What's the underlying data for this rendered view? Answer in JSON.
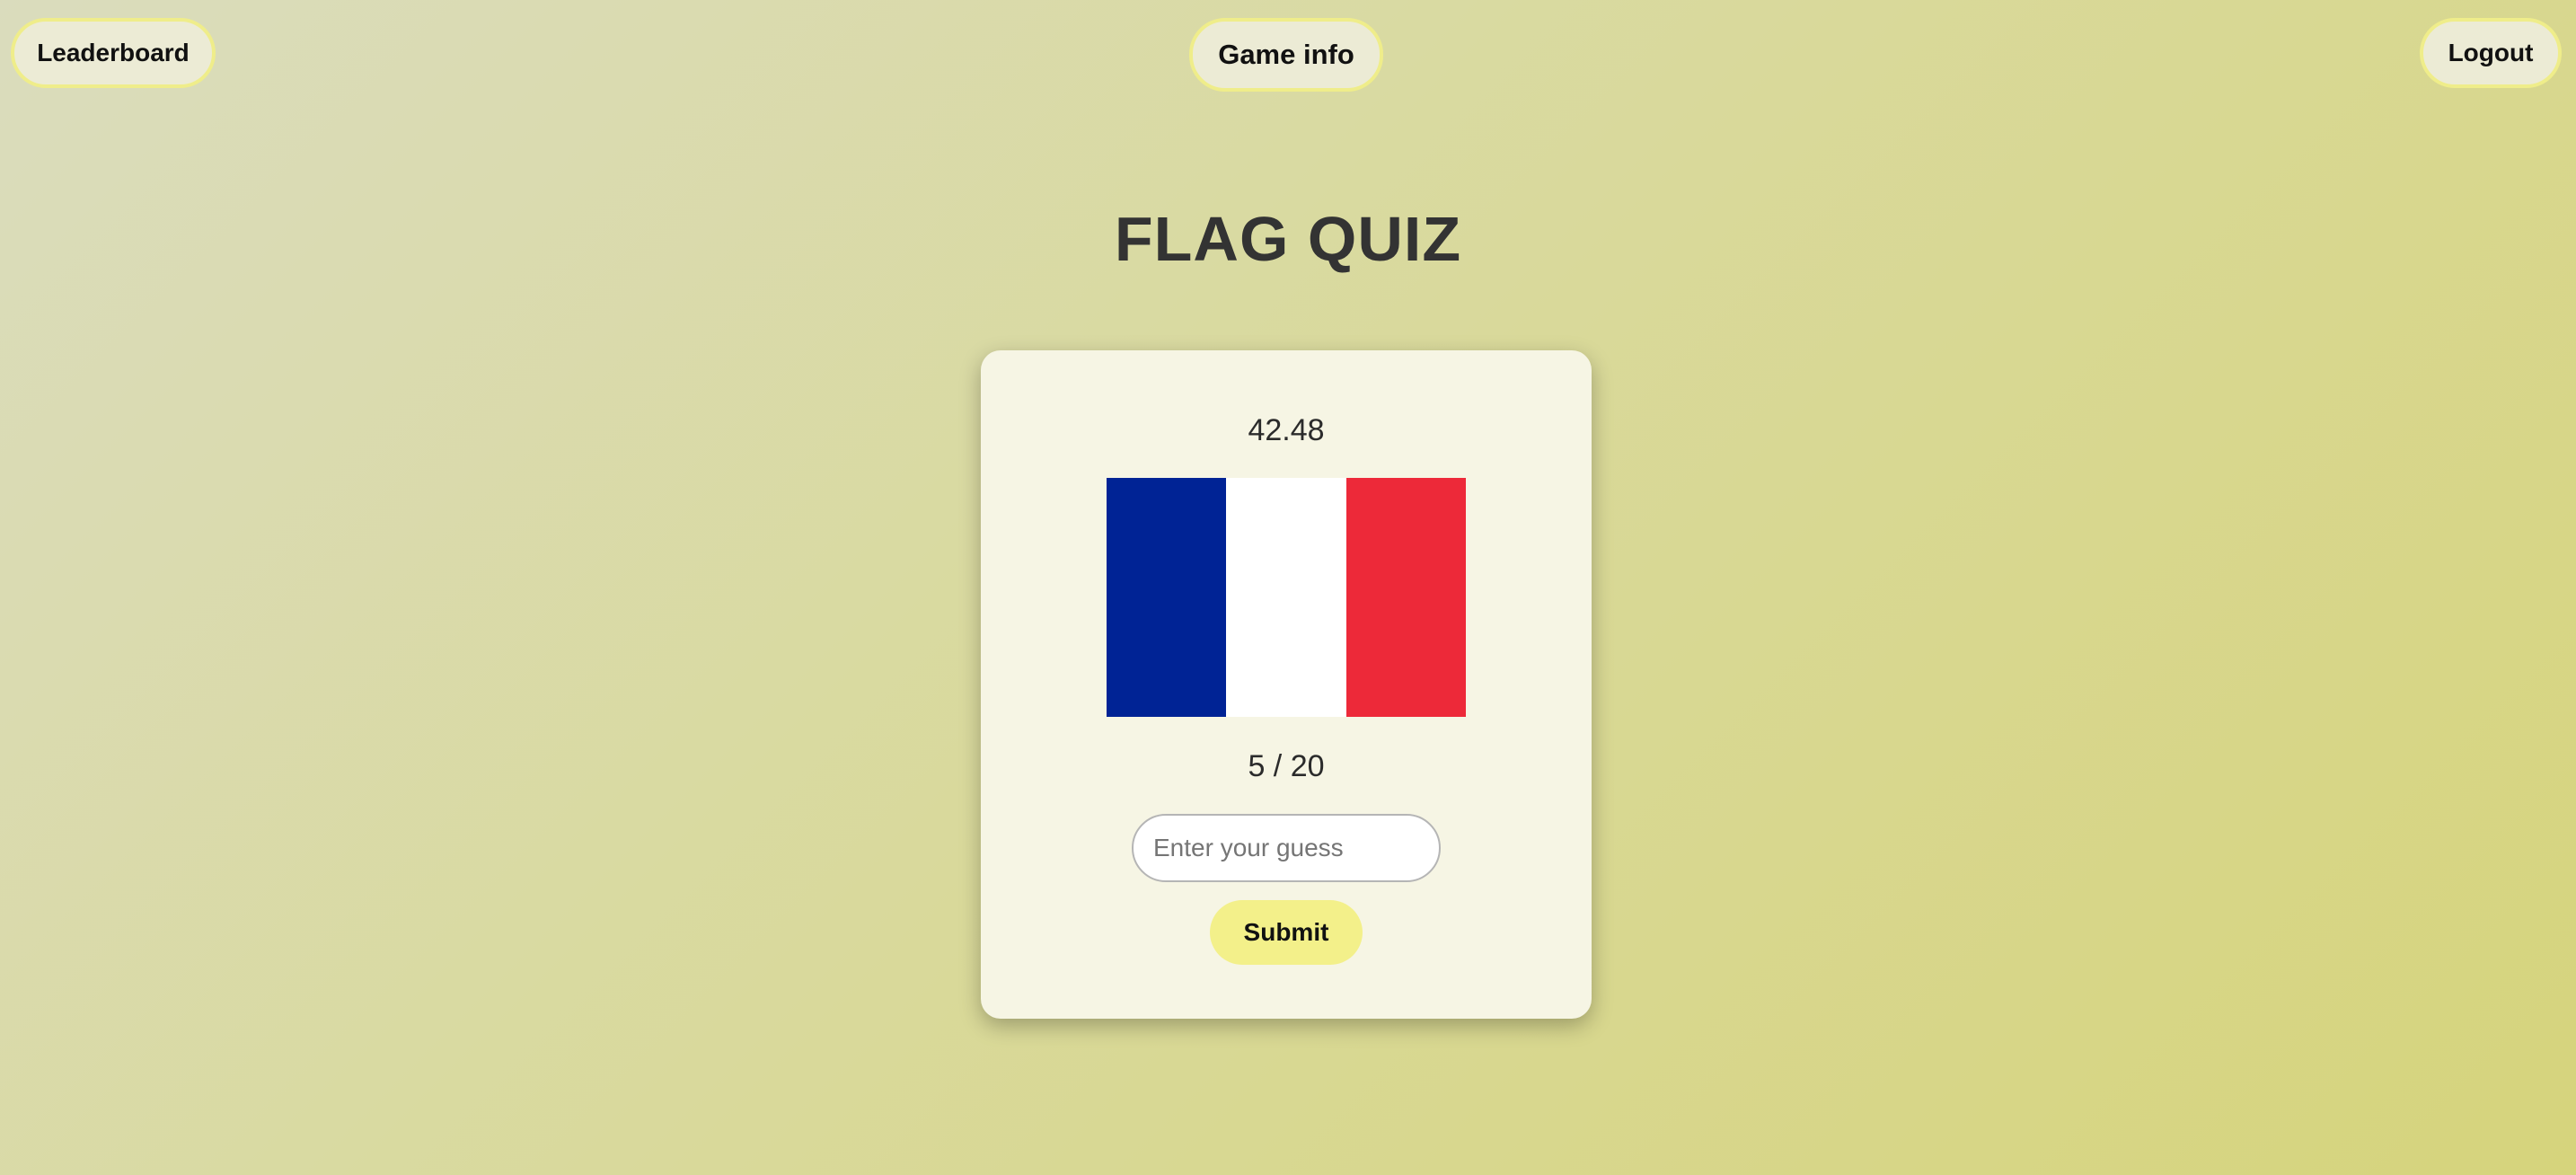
{
  "nav": {
    "leaderboard_label": "Leaderboard",
    "game_info_label": "Game info",
    "logout_label": "Logout"
  },
  "page": {
    "title": "FLAG QUIZ"
  },
  "quiz": {
    "timer": "42.48",
    "progress": "5 / 20",
    "guess_placeholder": "Enter your guess",
    "guess_value": "",
    "submit_label": "Submit",
    "flag": {
      "name": "flag-image",
      "stripes": [
        "#002395",
        "#ffffff",
        "#ed2939"
      ]
    }
  },
  "colors": {
    "accent": "#f3f08a",
    "button_border": "#efed8a",
    "card_bg": "#f6f5e4"
  }
}
